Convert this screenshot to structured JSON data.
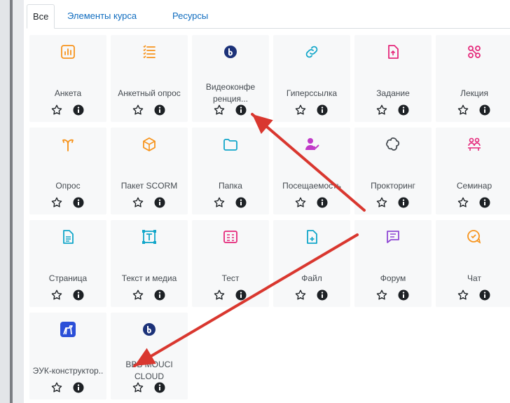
{
  "tabs": [
    {
      "label": "Все",
      "active": true
    },
    {
      "label": "Элементы курса",
      "active": false
    },
    {
      "label": "Ресурсы",
      "active": false
    }
  ],
  "activities": [
    {
      "label": "Анкета",
      "icon": "chart-icon",
      "color": "#f7941d"
    },
    {
      "label": "Анкетный опрос",
      "icon": "list-icon",
      "color": "#f7941d"
    },
    {
      "label": "Видеоконфе ренция...",
      "icon": "bbb-icon",
      "color": "#1c3279"
    },
    {
      "label": "Гиперссылка",
      "icon": "link-icon",
      "color": "#11a6c9"
    },
    {
      "label": "Задание",
      "icon": "assignment-icon",
      "color": "#e5297b"
    },
    {
      "label": "Лекция",
      "icon": "lesson-icon",
      "color": "#e5297b"
    },
    {
      "label": "Опрос",
      "icon": "choice-icon",
      "color": "#f7941d"
    },
    {
      "label": "Пакет SCORM",
      "icon": "package-icon",
      "color": "#f7941d"
    },
    {
      "label": "Папка",
      "icon": "folder-icon",
      "color": "#11a6c9"
    },
    {
      "label": "Посещаемость",
      "icon": "attendance-icon",
      "color": "#c13bc8"
    },
    {
      "label": "Прокторинг",
      "icon": "proctoring-icon",
      "color": "#444a50"
    },
    {
      "label": "Семинар",
      "icon": "workshop-icon",
      "color": "#e5297b"
    },
    {
      "label": "Страница",
      "icon": "page-icon",
      "color": "#11a6c9"
    },
    {
      "label": "Текст и медиа",
      "icon": "text-media-icon",
      "color": "#11a6c9"
    },
    {
      "label": "Тест",
      "icon": "quiz-icon",
      "color": "#e5297b"
    },
    {
      "label": "Файл",
      "icon": "file-icon",
      "color": "#11a6c9"
    },
    {
      "label": "Форум",
      "icon": "forum-icon",
      "color": "#8f49d4"
    },
    {
      "label": "Чат",
      "icon": "chat-icon",
      "color": "#f7941d"
    },
    {
      "label": "ЭУК-конструктор..",
      "icon": "euk-icon",
      "color": "#2b4fd8"
    },
    {
      "label": "BBB MOUCI CLOUD",
      "icon": "bbb-icon",
      "color": "#1c3279"
    }
  ],
  "annotation_color": "#d9372f"
}
